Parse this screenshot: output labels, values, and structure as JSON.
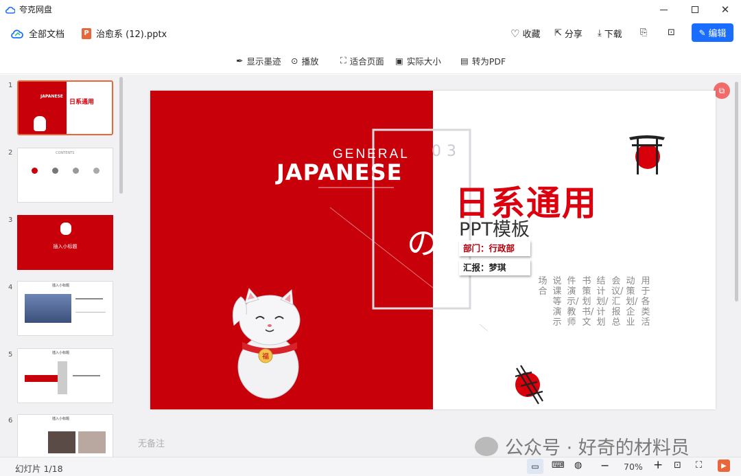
{
  "app": {
    "title": "夸克网盘"
  },
  "nav": {
    "all_docs": "全部文档",
    "file_name": "治愈系 (12).pptx",
    "favorite": "收藏",
    "share": "分享",
    "download": "下载",
    "edit": "编辑"
  },
  "toolbar": {
    "show_ink": "显示墨迹",
    "play": "播放",
    "fit_page": "适合页面",
    "actual_size": "实际大小",
    "to_pdf": "转为PDF"
  },
  "thumbs": [
    {
      "num": "1"
    },
    {
      "num": "2"
    },
    {
      "num": "3"
    },
    {
      "num": "4"
    },
    {
      "num": "5"
    },
    {
      "num": "6"
    }
  ],
  "thumb_text": {
    "t1_japanese": "JAPANESE",
    "t1_title": "日系通用",
    "t2_contents": "CONTENTS",
    "t3_title": "插入小标题",
    "t4_header": "插入小标题",
    "t5_header": "插入小标题",
    "t6_header": "插入小标题"
  },
  "slide": {
    "general": "GENERAL",
    "japanese": "JAPANESE",
    "no": "の",
    "date_num": "03",
    "main_title": "日系通用",
    "subtitle": "PPT模板",
    "dept": "部门：行政部",
    "reporter": "汇报：梦琪",
    "columns": [
      "用于各类活",
      "动策划/企业",
      "会议/汇报总",
      "结计划/计划",
      "书策划书/文",
      "件演示/教师",
      "说课等演示",
      "场合"
    ],
    "badge": "福"
  },
  "notes": {
    "placeholder": "无备注"
  },
  "watermark": "公众号 · 好奇的材料员",
  "status": {
    "slide_counter": "幻灯片 1/18",
    "zoom": "70%"
  },
  "colors": {
    "brand_red": "#c8000a",
    "accent_blue": "#1a6dff",
    "pptx_orange": "#e8663a"
  }
}
